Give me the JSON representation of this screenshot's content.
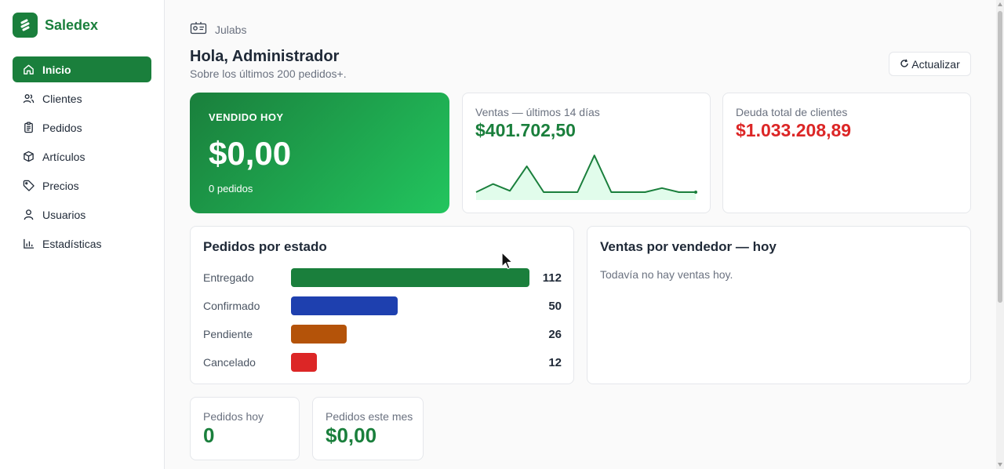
{
  "brand": {
    "name": "Saledex"
  },
  "nav": [
    {
      "label": "Inicio",
      "icon": "home-icon",
      "active": true
    },
    {
      "label": "Clientes",
      "icon": "users-icon",
      "active": false
    },
    {
      "label": "Pedidos",
      "icon": "clipboard-icon",
      "active": false
    },
    {
      "label": "Artículos",
      "icon": "box-icon",
      "active": false
    },
    {
      "label": "Precios",
      "icon": "tag-icon",
      "active": false
    },
    {
      "label": "Usuarios",
      "icon": "user-icon",
      "active": false
    },
    {
      "label": "Estadísticas",
      "icon": "bar-chart-icon",
      "active": false
    }
  ],
  "header": {
    "org_icon": "id-card-icon",
    "org": "Julabs",
    "greeting": "Hola, Administrador",
    "subtitle": "Sobre los últimos 200 pedidos+.",
    "refresh_label": "Actualizar",
    "refresh_icon": "refresh-icon"
  },
  "hero": {
    "label": "VENDIDO HOY",
    "value": "$0,00",
    "sub": "0 pedidos"
  },
  "sales_card": {
    "label": "Ventas — últimos 14 días",
    "value": "$401.702,50"
  },
  "debt_card": {
    "label": "Deuda total de clientes",
    "value": "$1.033.208,89"
  },
  "status_panel": {
    "title": "Pedidos por estado"
  },
  "seller_panel": {
    "title": "Ventas por vendedor — hoy",
    "empty": "Todavía no hay ventas hoy."
  },
  "mini_cards": {
    "today": {
      "label": "Pedidos hoy",
      "value": "0"
    },
    "month": {
      "label": "Pedidos este mes",
      "value": "$0,00"
    }
  },
  "colors": {
    "brand": "#1a7f3c",
    "danger": "#dc2626",
    "entregado": "#1a7f3c",
    "confirmado": "#1e40af",
    "pendiente": "#b45309",
    "cancelado": "#dc2626"
  },
  "chart_data": [
    {
      "type": "line",
      "name": "sparkline",
      "x": [
        1,
        2,
        3,
        4,
        5,
        6,
        7,
        8,
        9,
        10,
        11,
        12,
        13,
        14
      ],
      "values": [
        0,
        12,
        2,
        38,
        0,
        0,
        0,
        54,
        0,
        0,
        0,
        6,
        0,
        0
      ],
      "ylim": [
        0,
        60
      ]
    },
    {
      "type": "bar",
      "orientation": "horizontal",
      "categories": [
        "Entregado",
        "Confirmado",
        "Pendiente",
        "Cancelado"
      ],
      "values": [
        112,
        50,
        26,
        12
      ],
      "colors": [
        "#1a7f3c",
        "#1e40af",
        "#b45309",
        "#dc2626"
      ],
      "xlim": [
        0,
        112
      ]
    }
  ]
}
